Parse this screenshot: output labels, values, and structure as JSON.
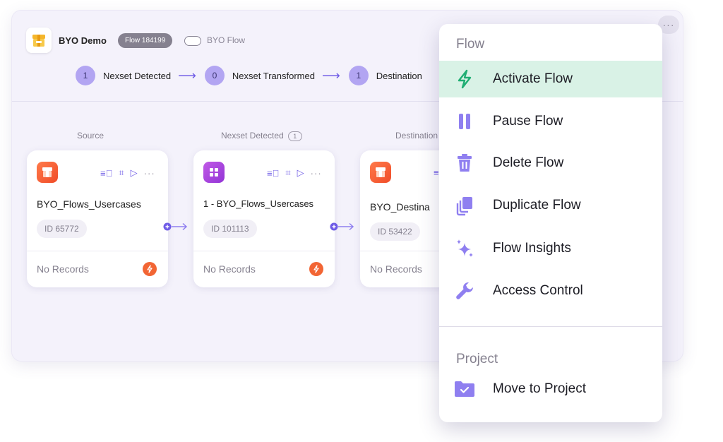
{
  "header": {
    "project_name": "BYO Demo",
    "flow_badge": "Flow 184199",
    "toggle_label": "BYO Flow"
  },
  "steps": [
    {
      "count": "1",
      "label": "Nexset Detected"
    },
    {
      "count": "0",
      "label": "Nexset Transformed"
    },
    {
      "count": "1",
      "label": "Destination"
    }
  ],
  "columns": {
    "source": "Source",
    "nexset": "Nexset Detected",
    "nexset_badge": "1",
    "destination": "Destination"
  },
  "cards": [
    {
      "name": "BYO_Flows_Usercases",
      "id": "ID 65772",
      "status": "No Records",
      "icon": "source-icon",
      "color": "#f04c28"
    },
    {
      "name": "1 - BYO_Flows_Usercases",
      "id": "ID 101113",
      "status": "No Records",
      "icon": "nexset-icon",
      "color": "#9334d6"
    },
    {
      "name": "BYO_Destina",
      "id": "ID 53422",
      "status": "No Records",
      "icon": "destination-icon",
      "color": "#f04c28"
    }
  ],
  "menu": {
    "section_flow": "Flow",
    "items": [
      {
        "label": "Activate Flow",
        "icon": "lightning-icon",
        "active": true
      },
      {
        "label": "Pause Flow",
        "icon": "pause-icon"
      },
      {
        "label": "Delete Flow",
        "icon": "trash-icon"
      },
      {
        "label": "Duplicate Flow",
        "icon": "duplicate-icon"
      },
      {
        "label": "Flow Insights",
        "icon": "sparkle-icon"
      },
      {
        "label": "Access Control",
        "icon": "wrench-icon"
      }
    ],
    "section_project": "Project",
    "project_item": {
      "label": "Move to Project",
      "icon": "folder-check-icon"
    }
  },
  "colors": {
    "accent": "#6f5ce6",
    "menu_icon": "#8f7ff0",
    "activate": "#1fae73",
    "active_bg": "#d9f2e6"
  }
}
